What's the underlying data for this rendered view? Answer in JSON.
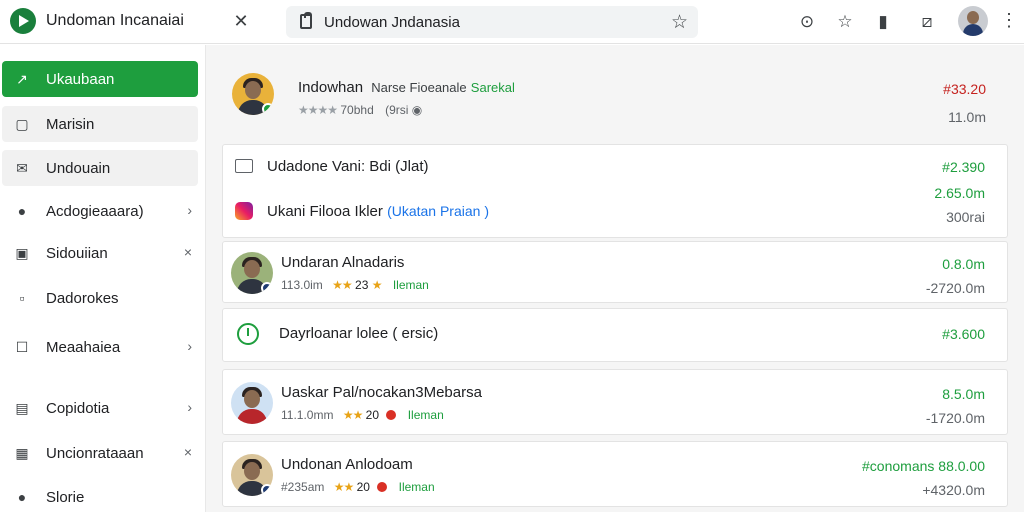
{
  "app": {
    "title": "Undoman Incanaiai",
    "search_value": "Undowan Jndanasia"
  },
  "icons": {
    "logo": "play-logo-icon",
    "close": "close-icon",
    "doc": "document-icon",
    "bookmark": "star-icon",
    "history": "clock-icon",
    "favorite": "star-outline-icon",
    "clipboard": "clipboard-icon",
    "screenshot": "image-icon",
    "menu": "more-vert-icon"
  },
  "colors": {
    "accent": "#1e9e3e",
    "negative": "#c5221f"
  },
  "sidebar": {
    "items": [
      {
        "label": "Ukaubaan",
        "icon": "chart-icon",
        "active": true
      },
      {
        "label": "Marisin",
        "icon": "file-icon"
      },
      {
        "label": "Undouain",
        "icon": "mail-open-icon"
      },
      {
        "label": "Acdogieaaara)",
        "icon": "account-icon"
      },
      {
        "label": "Sidouiian",
        "icon": "calendar-icon"
      },
      {
        "label": "Dadorokes",
        "icon": "square-icon"
      },
      {
        "label": "Meaahaiea",
        "icon": "edit-box-icon"
      },
      {
        "label": "Copidotia",
        "icon": "document-list-icon"
      },
      {
        "label": "Uncionrataaan",
        "icon": "calendar-grid-icon"
      },
      {
        "label": "Slorie",
        "icon": "circle-icon"
      }
    ]
  },
  "profile": {
    "name": "Indowhan",
    "subtitle": "Narse Fioeanale",
    "tag": "Sarekal",
    "rating_text": "70bhd",
    "extra": "(9rsi",
    "amount_top": "#33.20",
    "amount_bottom": "11.0m"
  },
  "cards": [
    {
      "line1": "Udadone Vani: Bdi (Jlat)",
      "line2": "Ukani Filooa Ikler",
      "line2_link": "(Ukatan Praian )",
      "amount1": "#2.390",
      "amount2": "2.65.0m",
      "amount3": "300rai"
    },
    {
      "title": "Undaran Alnadaris",
      "meta": "113.0im",
      "rating": "23",
      "tag": "Ileman",
      "amount1": "0.8.0m",
      "amount2": "-2720.0m"
    },
    {
      "title": "Dayrloanar lolee ( ersic)",
      "amount1": "#3.600"
    },
    {
      "title": "Uaskar Pal/nocakan3Mebarsa",
      "meta": "11.1.0mm",
      "rating": "20",
      "tag": "Ileman",
      "amount1": "8.5.0m",
      "amount2": "-1720.0m"
    },
    {
      "title": "Undonan Anlodoam",
      "meta": "#235am",
      "rating": "20",
      "tag": "Ileman",
      "amount1": "#conomans 88.0.00",
      "amount2": "+4320.0m"
    }
  ]
}
